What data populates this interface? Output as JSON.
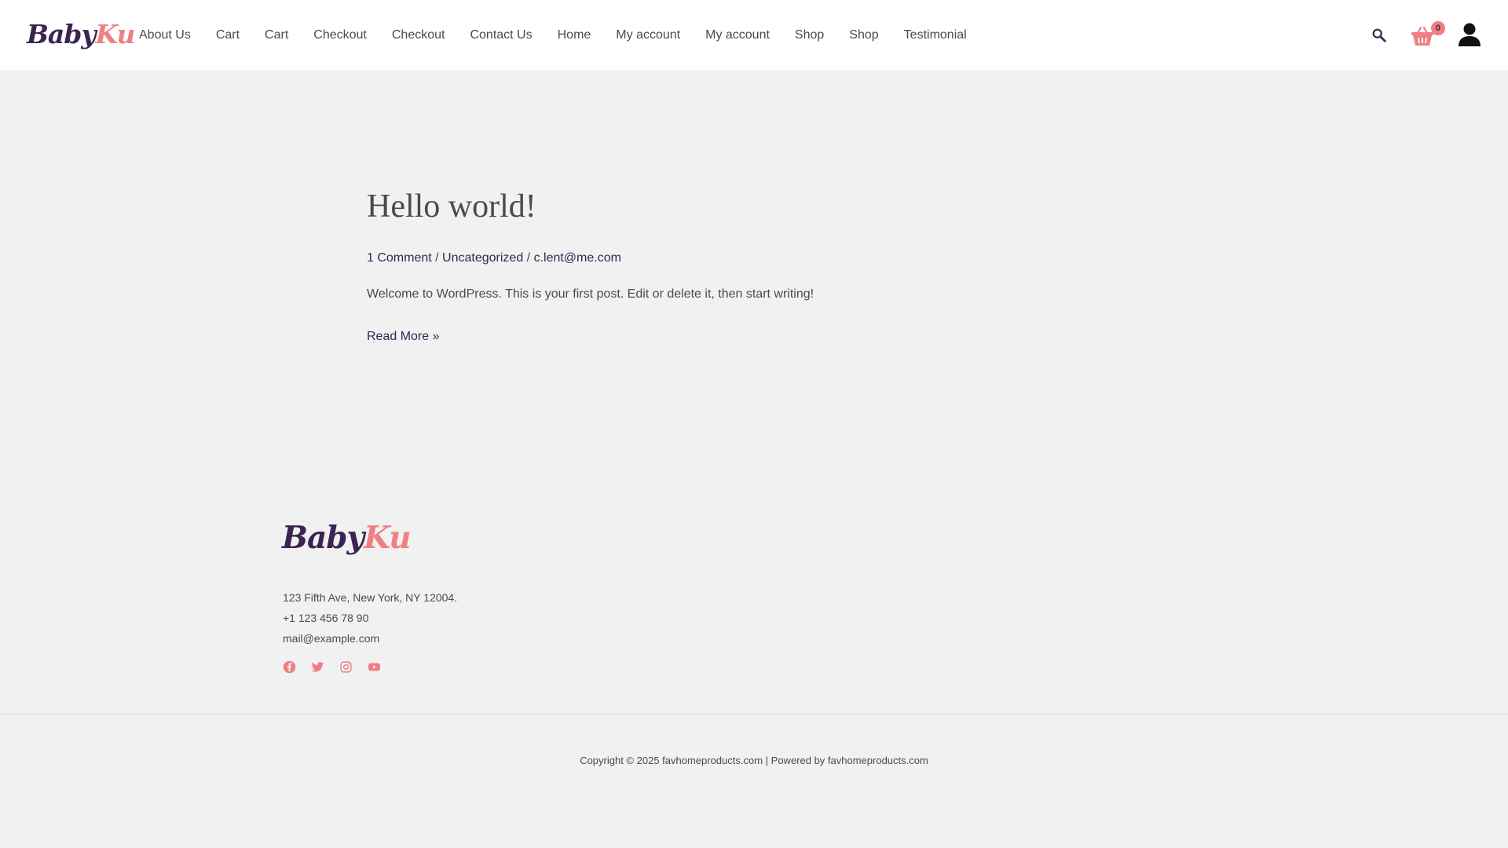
{
  "header": {
    "logo": {
      "part1": "Baby",
      "part2": "Ku"
    },
    "nav": [
      "About Us",
      "Cart",
      "Cart",
      "Checkout",
      "Checkout",
      "Contact Us",
      "Home",
      "My account",
      "My account",
      "Shop",
      "Shop",
      "Testimonial"
    ],
    "cart_count": "0",
    "icons": [
      "search-icon",
      "cart-icon",
      "user-icon"
    ]
  },
  "post": {
    "title": "Hello world!",
    "meta": {
      "comments": "1 Comment",
      "sep1": " / ",
      "category": "Uncategorized",
      "sep2": " / ",
      "author": "c.lent@me.com"
    },
    "excerpt": "Welcome to WordPress. This is your first post. Edit or delete it, then start writing!",
    "read_more": "Read More »"
  },
  "footer": {
    "logo": {
      "part1": "Baby",
      "part2": "Ku"
    },
    "address": "123 Fifth Ave, New York, NY 12004.",
    "phone": "+1 123 456 78 90",
    "email": "mail@example.com",
    "social": [
      "facebook-icon",
      "twitter-icon",
      "instagram-icon",
      "youtube-icon"
    ],
    "copyright": "Copyright © 2025 favhomeproducts.com | Powered by favhomeproducts.com"
  },
  "colors": {
    "brand_dark": "#3b2352",
    "brand_pink": "#ee8084",
    "background": "#f1f1f1",
    "text": "#4a4a4a"
  }
}
